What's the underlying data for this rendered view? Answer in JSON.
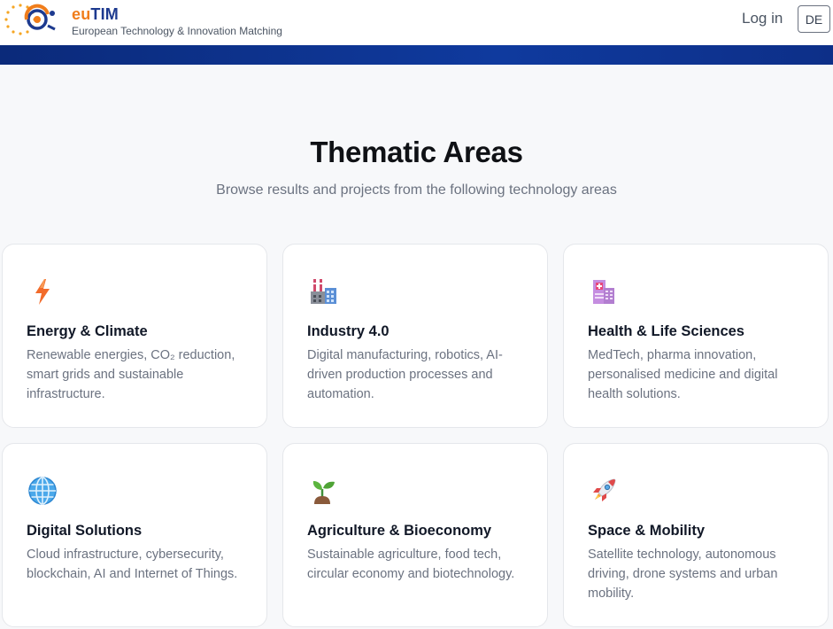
{
  "header": {
    "brand_eu": "eu",
    "brand_tim": "TIM",
    "tagline": "European Technology & Innovation Matching",
    "login_label": "Log in",
    "language_label": "DE"
  },
  "hero": {
    "title": "Thematic Areas",
    "subtitle": "Browse results and projects from the following technology areas"
  },
  "areas": [
    {
      "icon": "lightning-icon",
      "title": "Energy & Climate",
      "description": "Renewable energies, CO₂ reduction, smart grids and sustainable infrastructure."
    },
    {
      "icon": "factory-icon",
      "title": "Industry 4.0",
      "description": "Digital manufacturing, robotics, AI-driven production processes and automation."
    },
    {
      "icon": "hospital-icon",
      "title": "Health & Life Sciences",
      "description": "MedTech, pharma innovation, personalised medicine and digital health solutions."
    },
    {
      "icon": "globe-icon",
      "title": "Digital Solutions",
      "description": "Cloud infrastructure, cybersecurity, blockchain, AI and Internet of Things."
    },
    {
      "icon": "seedling-icon",
      "title": "Agriculture & Bioeconomy",
      "description": "Sustainable agriculture, food tech, circular economy and biotechnology."
    },
    {
      "icon": "rocket-icon",
      "title": "Space & Mobility",
      "description": "Satellite technology, autonomous driving, drone systems and urban mobility."
    }
  ],
  "colors": {
    "brand_orange": "#f07d1b",
    "brand_blue": "#1d3a8f",
    "band_blue": "#0f3a9e"
  }
}
